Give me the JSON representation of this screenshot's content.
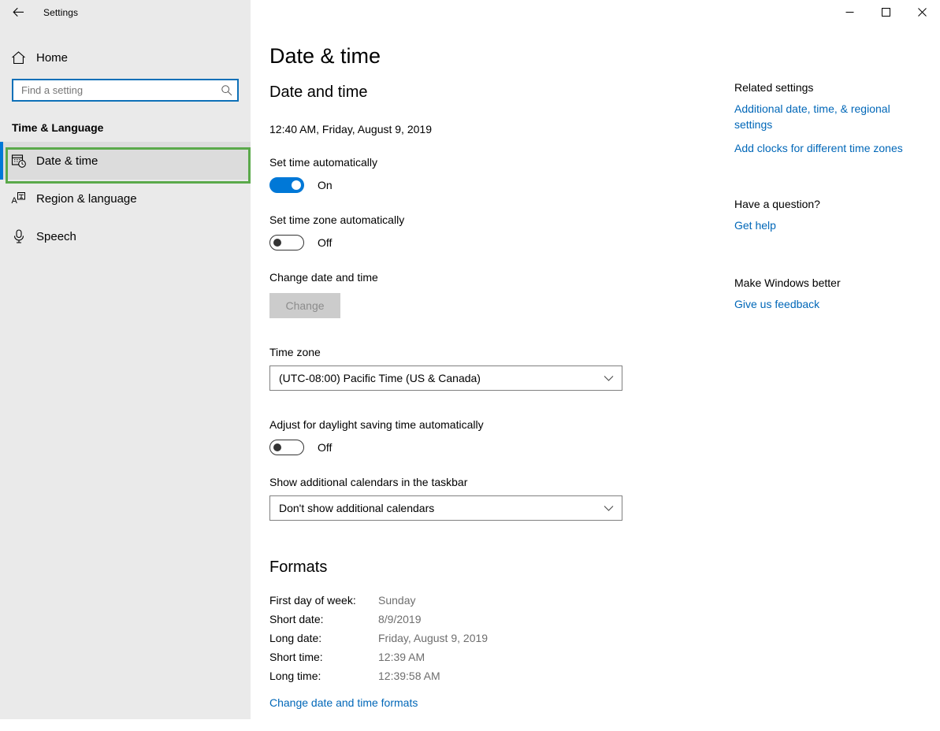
{
  "window": {
    "app_title": "Settings",
    "back_icon": "back-arrow-icon",
    "minimize_label": "Minimize",
    "maximize_label": "Maximize",
    "close_label": "Close"
  },
  "sidebar": {
    "home": {
      "label": "Home",
      "icon": "home-icon"
    },
    "search": {
      "placeholder": "Find a setting",
      "value": "",
      "icon": "search-icon"
    },
    "section_title": "Time & Language",
    "items": [
      {
        "label": "Date & time",
        "icon": "calendar-clock-icon",
        "selected": true
      },
      {
        "label": "Region & language",
        "icon": "language-icon",
        "selected": false
      },
      {
        "label": "Speech",
        "icon": "microphone-icon",
        "selected": false
      }
    ],
    "annotation_color": "#5aa94a",
    "accent_color": "#0078d7"
  },
  "main": {
    "page_title": "Date & time",
    "section_date_time": {
      "heading": "Date and time",
      "current_datetime": "12:40 AM, Friday, August 9, 2019",
      "set_time_auto": {
        "label": "Set time automatically",
        "state": "On",
        "on": true
      },
      "set_timezone_auto": {
        "label": "Set time zone automatically",
        "state": "Off",
        "on": false
      },
      "change_date_time": {
        "label": "Change date and time",
        "button_label": "Change",
        "disabled": true
      },
      "time_zone": {
        "label": "Time zone",
        "value": "(UTC-08:00) Pacific Time (US & Canada)",
        "arrow_icon": "chevron-down-icon"
      },
      "dst": {
        "label": "Adjust for daylight saving time automatically",
        "state": "Off",
        "on": false
      },
      "additional_calendars": {
        "label": "Show additional calendars in the taskbar",
        "value": "Don't show additional calendars",
        "arrow_icon": "chevron-down-icon"
      }
    },
    "section_formats": {
      "heading": "Formats",
      "rows": [
        {
          "key": "First day of week:",
          "value": "Sunday"
        },
        {
          "key": "Short date:",
          "value": "8/9/2019"
        },
        {
          "key": "Long date:",
          "value": "Friday, August 9, 2019"
        },
        {
          "key": "Short time:",
          "value": "12:39 AM"
        },
        {
          "key": "Long time:",
          "value": "12:39:58 AM"
        }
      ],
      "link": "Change date and time formats"
    }
  },
  "right_panel": {
    "related_settings": {
      "heading": "Related settings",
      "links": [
        "Additional date, time, & regional settings",
        "Add clocks for different time zones"
      ]
    },
    "have_a_question": {
      "heading": "Have a question?",
      "links": [
        "Get help"
      ]
    },
    "make_windows_better": {
      "heading": "Make Windows better",
      "links": [
        "Give us feedback"
      ]
    }
  },
  "colors": {
    "accent_blue": "#0078d7",
    "link_blue": "#0067b8",
    "sidebar_bg": "#eaeaea",
    "annotation_green": "#5aa94a"
  }
}
